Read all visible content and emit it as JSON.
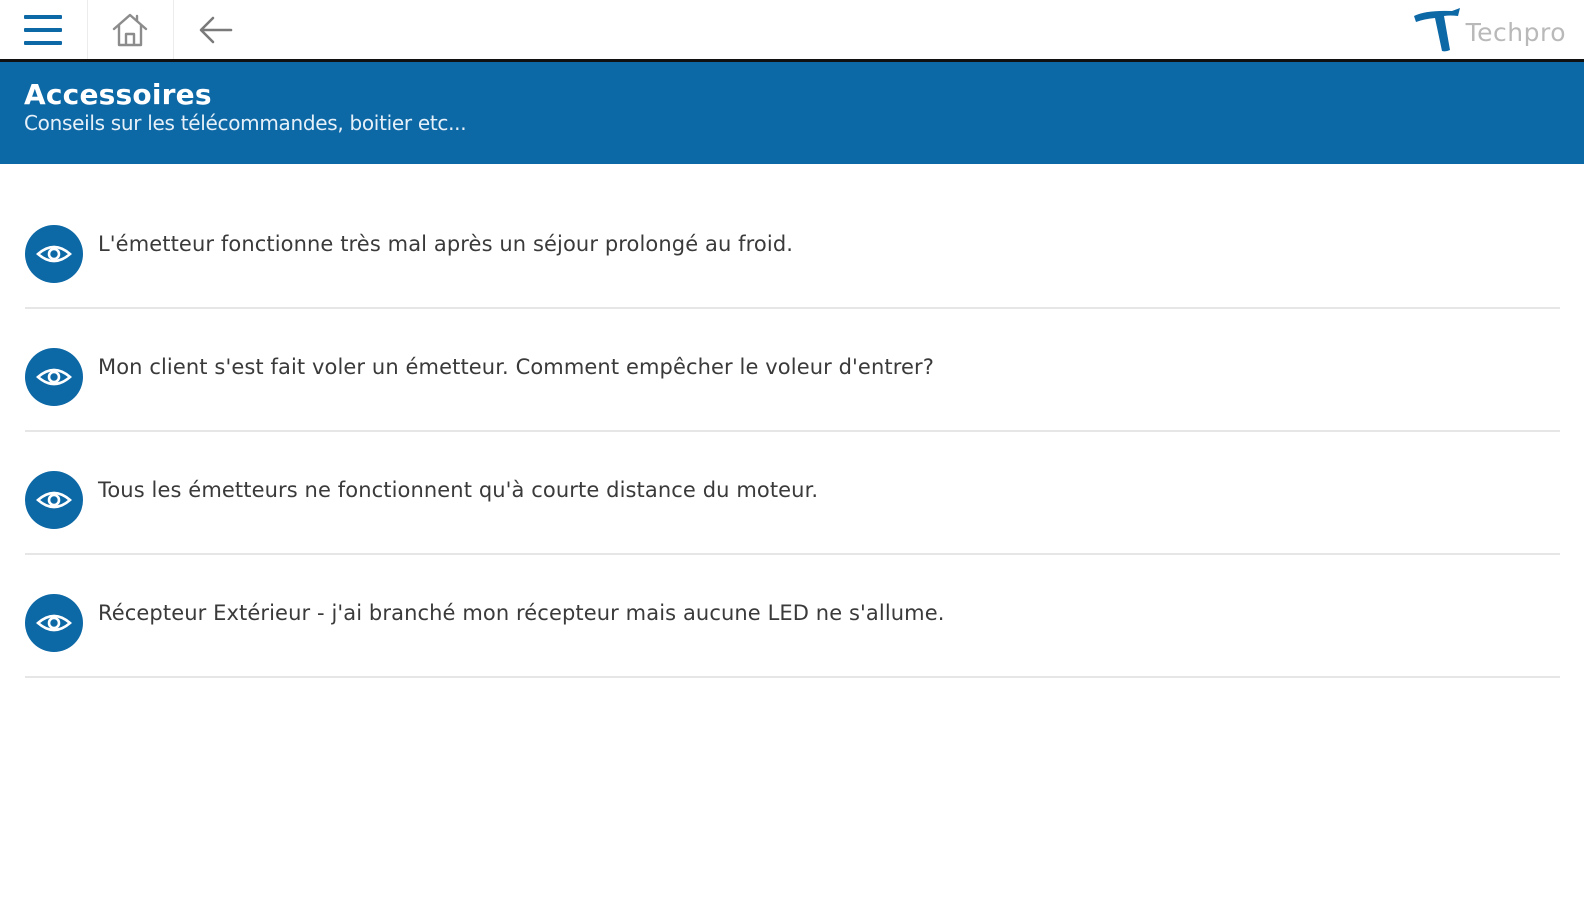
{
  "toolbar": {
    "menu_icon": "hamburger-menu-icon",
    "home_icon": "home-icon",
    "back_icon": "arrow-left-icon",
    "brand_name": "Techpro",
    "brand_color": "#0d68a6"
  },
  "banner": {
    "title": "Accessoires",
    "subtitle": "Conseils sur les télécommandes, boitier etc...",
    "background": "#0d68a6"
  },
  "items": [
    {
      "icon": "eye-icon",
      "label": "L'émetteur fonctionne très mal après un séjour prolongé au froid."
    },
    {
      "icon": "eye-icon",
      "label": "Mon client s'est fait voler un émetteur. Comment empêcher le voleur d'entrer?"
    },
    {
      "icon": "eye-icon",
      "label": "Tous les émetteurs ne fonctionnent qu'à courte distance du moteur."
    },
    {
      "icon": "eye-icon",
      "label": "Récepteur Extérieur - j'ai branché mon récepteur mais aucune LED ne s'allume."
    }
  ]
}
